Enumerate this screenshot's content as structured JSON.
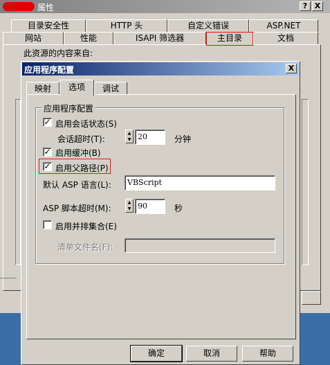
{
  "outer_window": {
    "title": "属性",
    "help_button": "?",
    "close_button": "X",
    "tabs_row1": [
      {
        "label": "目录安全性"
      },
      {
        "label": "HTTP 头"
      },
      {
        "label": "自定义错误"
      },
      {
        "label": "ASP.NET"
      }
    ],
    "tabs_row2": [
      {
        "label": "网站"
      },
      {
        "label": "性能"
      },
      {
        "label": "ISAPI 筛选器"
      },
      {
        "label": "主目录"
      },
      {
        "label": "文档"
      }
    ],
    "content_source_label": "此资源的内容来自:"
  },
  "dialog": {
    "title": "应用程序配置",
    "close_button": "X",
    "tabs": [
      {
        "label": "映射"
      },
      {
        "label": "选项"
      },
      {
        "label": "调试"
      }
    ],
    "group_title": "应用程序配置",
    "enable_session": {
      "label": "启用会话状态(S)",
      "checked": true,
      "mark": "✓"
    },
    "session_timeout": {
      "label": "会话超时(T):",
      "value": "20",
      "unit": "分钟"
    },
    "enable_buffering": {
      "label": "启用缓冲(B)",
      "checked": true,
      "mark": "✓"
    },
    "enable_parent_paths": {
      "label": "启用父路径(P)",
      "checked": true,
      "mark": "✓"
    },
    "default_language": {
      "label": "默认 ASP 语言(L):",
      "value": "VBScript"
    },
    "script_timeout": {
      "label": "ASP 脚本超时(M):",
      "value": "90",
      "unit": "秒"
    },
    "enable_side_by_side": {
      "label": "启用并排集合(E)",
      "checked": false,
      "mark": ""
    },
    "manifest_file": {
      "label": "清单文件名(F):",
      "value": ""
    },
    "buttons": {
      "ok": "确定",
      "cancel": "取消",
      "help": "帮助"
    }
  }
}
